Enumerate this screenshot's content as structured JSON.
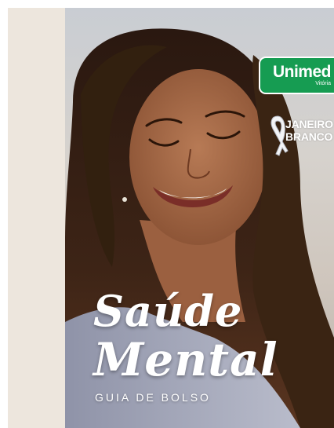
{
  "brand": {
    "name": "Unimed",
    "city": "Vitória",
    "color": "#169c52"
  },
  "campaign": {
    "line1": "JANEIRO",
    "line2": "BRANCO",
    "icon": "ribbon-icon"
  },
  "cover": {
    "title_line1": "Saúde",
    "title_line2": "Mental",
    "subtitle": "GUIA DE BOLSO"
  },
  "colors": {
    "left_strip": "#ede6dd",
    "title_text": "#ffffff"
  }
}
